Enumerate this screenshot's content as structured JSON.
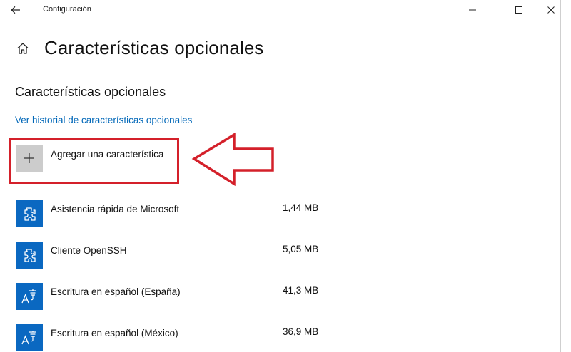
{
  "titlebar": {
    "app_title": "Configuración",
    "icons": {
      "back": "arrow-left-icon",
      "minimize": "minimize-icon",
      "maximize": "maximize-icon",
      "close": "close-icon"
    }
  },
  "header": {
    "home_icon": "home-icon",
    "page_title": "Características opcionales"
  },
  "section": {
    "title": "Características opcionales",
    "history_link": "Ver historial de características opcionales"
  },
  "add_feature": {
    "label": "Agregar una característica",
    "icon": "plus-icon"
  },
  "features": [
    {
      "name": "Asistencia rápida de Microsoft",
      "size": "1,44 MB",
      "icon": "puzzle-icon"
    },
    {
      "name": "Cliente OpenSSH",
      "size": "5,05 MB",
      "icon": "puzzle-icon"
    },
    {
      "name": "Escritura en español (España)",
      "size": "41,3 MB",
      "icon": "language-icon"
    },
    {
      "name": "Escritura en español (México)",
      "size": "36,9 MB",
      "icon": "language-icon"
    }
  ],
  "colors": {
    "accent": "#0067b8",
    "icon_tile": "#0a68c1",
    "highlight": "#d4202a",
    "add_tile": "#cccccc"
  }
}
